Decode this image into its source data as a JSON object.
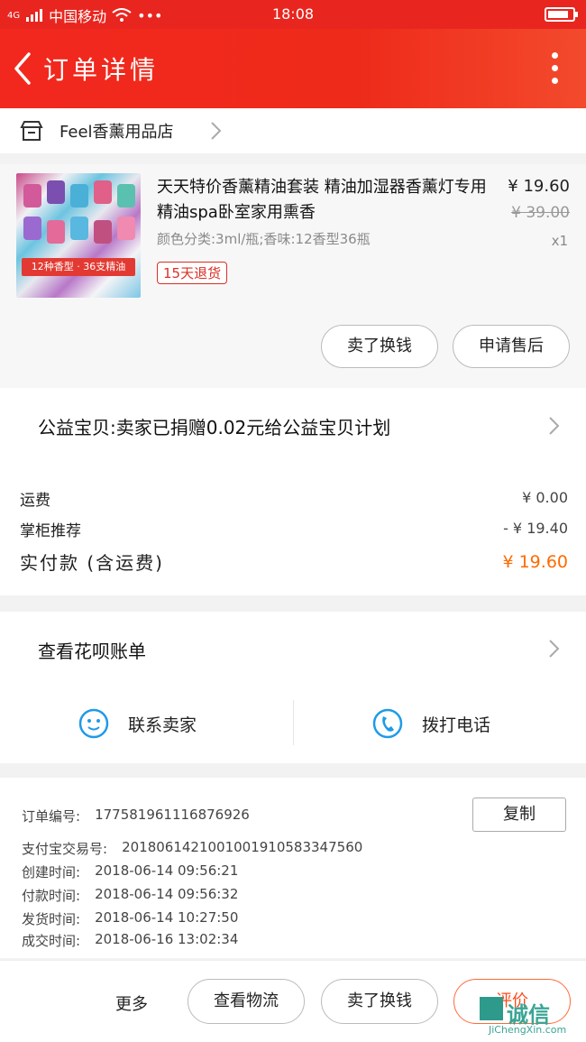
{
  "status_bar": {
    "carrier": "中国移动",
    "time": "18:08",
    "signal": "4G"
  },
  "header": {
    "title": "订单详情"
  },
  "store": {
    "name": "Feel香薰用品店"
  },
  "product": {
    "title": "天天特价香薰精油套装 精油加湿器香薰灯专用精油spa卧室家用熏香",
    "spec": "颜色分类:3ml/瓶;香味:12香型36瓶",
    "tag": "15天退货",
    "price": "¥ 19.60",
    "original_price": "¥ 39.00",
    "quantity": "x1",
    "thumb_caption": "12种香型 · 36支精油",
    "buttons": [
      "卖了换钱",
      "申请售后"
    ]
  },
  "charity": {
    "text": "公益宝贝:卖家已捐赠0.02元给公益宝贝计划"
  },
  "summary": {
    "rows": [
      {
        "label": "运费",
        "value": "¥ 0.00"
      },
      {
        "label": "掌柜推荐",
        "value": "- ¥ 19.40"
      }
    ],
    "paid_label": "实付款 (含运费)",
    "paid_value": "¥ 19.60"
  },
  "huabei": {
    "label": "查看花呗账单"
  },
  "contact": {
    "seller": "联系卖家",
    "call": "拨打电话"
  },
  "order_info": {
    "copy_label": "复制",
    "rows": [
      {
        "label": "订单编号:",
        "value": "177581961116876926"
      },
      {
        "label": "支付宝交易号:",
        "value": "2018061421001001910583347560"
      },
      {
        "label": "创建时间:",
        "value": "2018-06-14 09:56:21"
      },
      {
        "label": "付款时间:",
        "value": "2018-06-14 09:56:32"
      },
      {
        "label": "发货时间:",
        "value": "2018-06-14 10:27:50"
      },
      {
        "label": "成交时间:",
        "value": "2018-06-16 13:02:34"
      }
    ]
  },
  "bottom_bar": {
    "more": "更多",
    "buttons": [
      "查看物流",
      "卖了换钱",
      "评价"
    ]
  },
  "watermark": {
    "text": "诚信",
    "url": "JiChengXin.com"
  },
  "colors": {
    "header": "#e8261f",
    "accent": "#ff6a00",
    "tag": "#d93025"
  }
}
